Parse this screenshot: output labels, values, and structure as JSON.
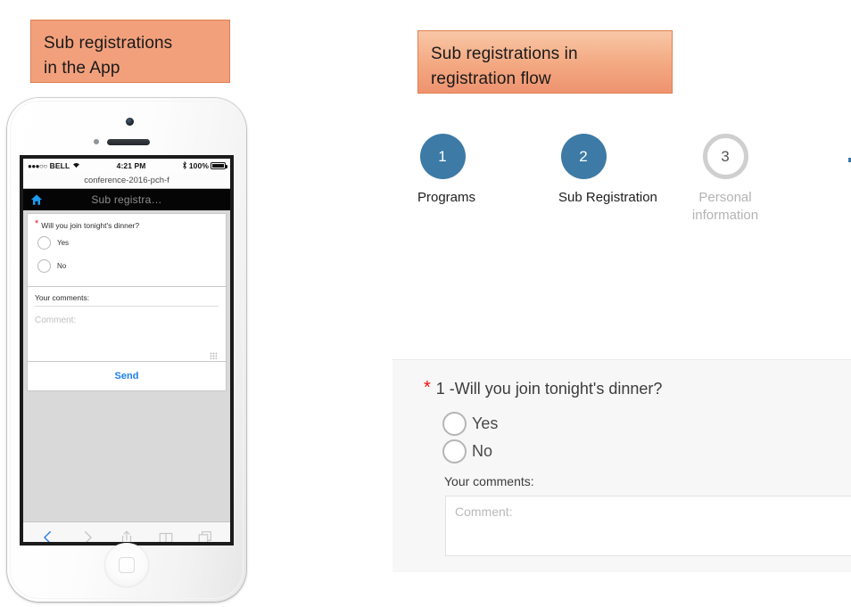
{
  "callouts": {
    "app": {
      "line1": "Sub registrations",
      "line2": "in the App"
    },
    "flow": {
      "line1": "Sub registrations in",
      "line2": "registration flow"
    }
  },
  "phone": {
    "status_bar": {
      "signal_dots": "●●●○○",
      "carrier": "BELL",
      "wifi_icon": "wifi-icon",
      "time": "4:21 PM",
      "bluetooth_icon": "bluetooth-icon",
      "battery_percent": "100%",
      "battery_icon": "battery-full-icon"
    },
    "url_bar": {
      "value": "conference-2016-pch-f"
    },
    "app_nav": {
      "home_icon": "home-icon",
      "title": "Sub registra…"
    },
    "form": {
      "required_marker": "*",
      "question": "Will you join tonight's dinner?",
      "options": [
        {
          "label": "Yes"
        },
        {
          "label": "No"
        }
      ],
      "comments_label": "Your comments:",
      "comment_placeholder": "Comment:",
      "send_label": "Send"
    },
    "toolbar": [
      {
        "name": "back-icon",
        "state": "enabled"
      },
      {
        "name": "forward-icon",
        "state": "disabled"
      },
      {
        "name": "share-icon",
        "state": "enabled"
      },
      {
        "name": "bookmarks-icon",
        "state": "enabled"
      },
      {
        "name": "tabs-icon",
        "state": "enabled"
      }
    ]
  },
  "stepper": {
    "steps": [
      {
        "number": "1",
        "label": "Programs",
        "state": "complete"
      },
      {
        "number": "2",
        "label": "Sub Registration",
        "state": "current"
      },
      {
        "number": "3",
        "label": "Personal information",
        "state": "upcoming"
      }
    ]
  },
  "form_panel": {
    "required_marker": "*",
    "question": "1 -Will you join tonight's dinner?",
    "options": [
      {
        "label": "Yes"
      },
      {
        "label": "No"
      }
    ],
    "comments_label": "Your comments:",
    "comment_placeholder": "Comment:"
  },
  "colors": {
    "callout_app_bg": "#f2a07c",
    "callout_flow_bg_top": "#f9c7a7",
    "callout_flow_bg_bottom": "#ee9370",
    "callout_border": "#e08050",
    "step_active": "#3d7aa6",
    "step_inactive": "#cfcfcf",
    "required_red": "#e81010",
    "link_blue": "#1e7ff0",
    "ios_blue": "#1e9bf0"
  }
}
